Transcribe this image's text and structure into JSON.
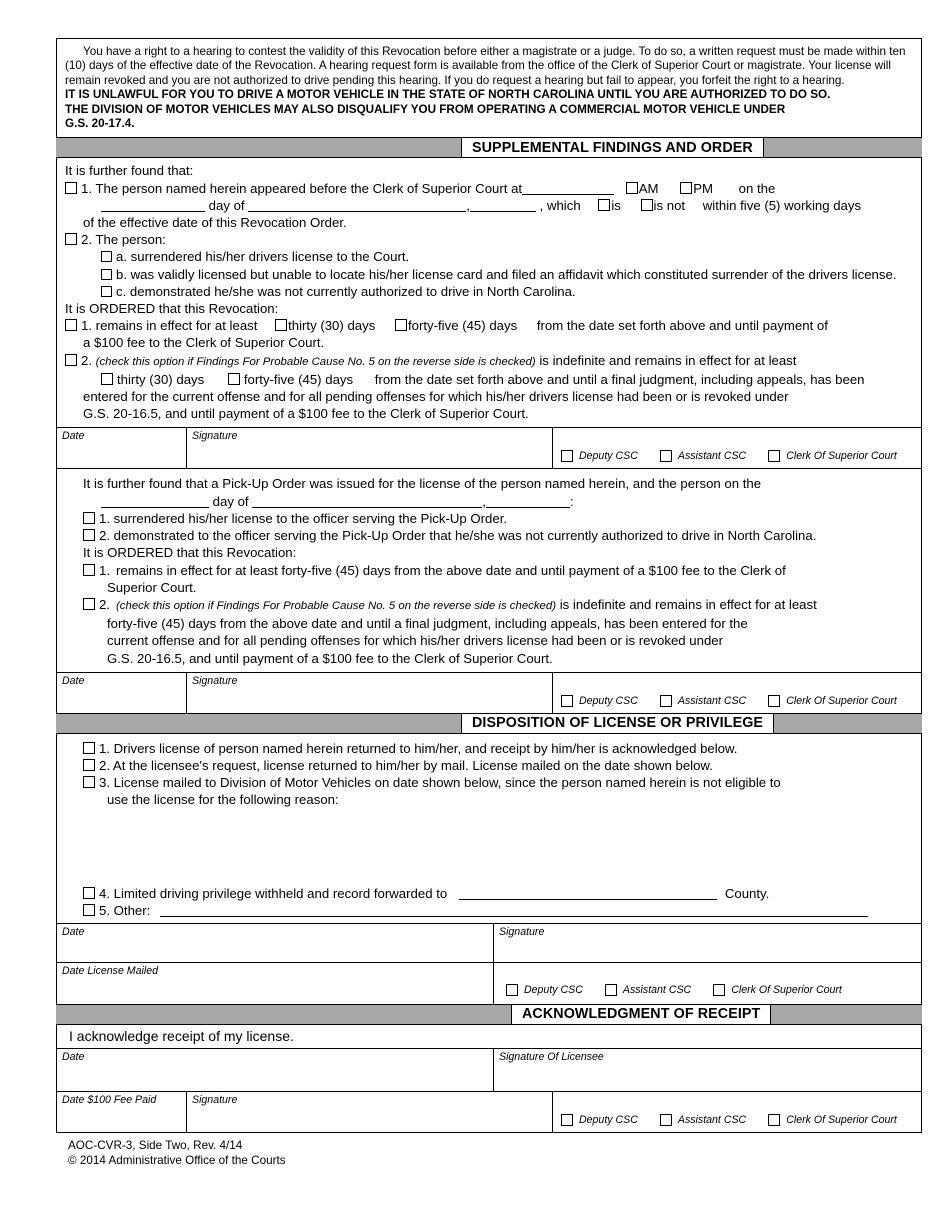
{
  "form": {
    "intro": {
      "p1": "You have a right to a hearing to contest the validity of this Revocation before either a magistrate or a judge. To do so, a written request must be made within ten (10) days of the effective date of the Revocation. A hearing request form is available from the office of the Clerk of Superior Court or magistrate. Your license will remain revoked and you are not authorized to drive pending this hearing. If you do request a hearing but fail to appear, you forfeit the right to a hearing.",
      "bold1": "IT IS UNLAWFUL FOR YOU TO DRIVE A MOTOR VEHICLE IN THE STATE OF NORTH CAROLINA UNTIL YOU ARE AUTHORIZED TO DO SO.",
      "bold2": "THE DIVISION OF MOTOR VEHICLES MAY ALSO DISQUALIFY YOU FROM OPERATING A COMMERCIAL MOTOR VEHICLE UNDER",
      "bold3": "G.S. 20-17.4."
    },
    "sections": {
      "supplemental": "SUPPLEMENTAL FINDINGS AND ORDER",
      "disposition": "DISPOSITION OF LICENSE OR PRIVILEGE",
      "acknowledgment": "ACKNOWLEDGMENT OF RECEIPT"
    },
    "supplemental": {
      "lead": "It is further found that:",
      "item1": {
        "num": "1.",
        "t1": "The person named herein appeared before the Clerk of Superior Court at",
        "am": "AM",
        "pm": "PM",
        "t2": "on the",
        "t3": "day of",
        "t4": ",",
        "t5": ", which",
        "is": "is",
        "isnot": "is not",
        "t6": "within five (5) working days",
        "t7": "of the effective date of this Revocation Order."
      },
      "item2": {
        "num": "2.",
        "title": "The person:",
        "a": "a.  surrendered his/her drivers license to the Court.",
        "b": "b.  was validly licensed but unable to locate his/her license card and filed an affidavit which constituted surrender of the drivers license.",
        "c": "c.  demonstrated he/she was not currently authorized to drive in North Carolina."
      },
      "ordered_lead": "It is ORDERED that this Revocation:",
      "ord1": {
        "num": "1.",
        "t1": "remains in effect for at least",
        "thirty": "thirty (30) days",
        "fortyfive": "forty-five (45) days",
        "t2": "from the date set forth above and until payment of",
        "t3": "a $100 fee to the Clerk of Superior Court."
      },
      "ord2": {
        "num": "2.",
        "note": "(check this option if Findings For Probable Cause No. 5 on the reverse side is checked)",
        "t1": "is indefinite and remains in effect for at least",
        "thirty": "thirty (30) days",
        "fortyfive": "forty-five (45) days",
        "t2": "from the date set forth above and until a final judgment, including appeals, has been",
        "t3": "entered for the current offense and for all pending offenses for which his/her drivers license had been or is revoked under",
        "t4": "G.S. 20-16.5, and until payment of a $100 fee to the Clerk of Superior Court."
      }
    },
    "pickup": {
      "lead1": "It is further found that a Pick-Up Order was issued for the license of the person named herein, and the person on the",
      "t3": "day of",
      "t4": ",",
      "t5": ":",
      "item1": "1.   surrendered his/her license to the officer serving the Pick-Up Order.",
      "item2": "2.   demonstrated to the officer serving the Pick-Up Order that he/she was not currently authorized to drive in North Carolina.",
      "ordered_lead": "It is ORDERED that this Revocation:",
      "ord1": {
        "num": "1.",
        "t1": "remains in effect for at least forty-five (45) days from the above date and until payment of a $100 fee to the Clerk of",
        "t2": "Superior Court."
      },
      "ord2": {
        "num": "2.",
        "note": "(check this option if Findings For Probable Cause No. 5 on the reverse side is checked)",
        "t1": "is indefinite and remains in effect for at least",
        "t2": "forty-five (45) days from the above date and until a final judgment, including appeals, has been entered for the",
        "t3": "current offense and for all pending offenses for which his/her drivers license had been or is revoked under",
        "t4": "G.S. 20-16.5, and until payment of a $100 fee to the Clerk of Superior Court."
      }
    },
    "disposition": {
      "item1": "1.   Drivers license of person named herein returned to him/her, and receipt by him/her is acknowledged below.",
      "item2": "2.   At the licensee's request, license returned to him/her by mail. License mailed on the date shown below.",
      "item3a": "3.   License mailed to Division of Motor Vehicles on date shown below, since the person named herein is not eligible to",
      "item3b": "use the license for the following reason:",
      "item4a": "4.   Limited driving privilege withheld and record forwarded to",
      "item4b": "County.",
      "item5": "5.   Other:"
    },
    "acknowledgment": {
      "statement": "I acknowledge receipt of my license.",
      "date_label": "Date",
      "sig_label": "Signature Of Licensee",
      "fee_label": "Date $100 Fee Paid",
      "fee_sig_label": "Signature"
    },
    "labels": {
      "date": "Date",
      "signature": "Signature",
      "date_license_mailed": "Date License Mailed",
      "deputy_csc": "Deputy CSC",
      "assistant_csc": "Assistant CSC",
      "clerk_of_superior_court": "Clerk Of Superior Court"
    },
    "footer": {
      "line1": "AOC-CVR-3, Side Two, Rev. 4/14",
      "line2": "© 2014 Administrative Office of the Courts"
    }
  }
}
